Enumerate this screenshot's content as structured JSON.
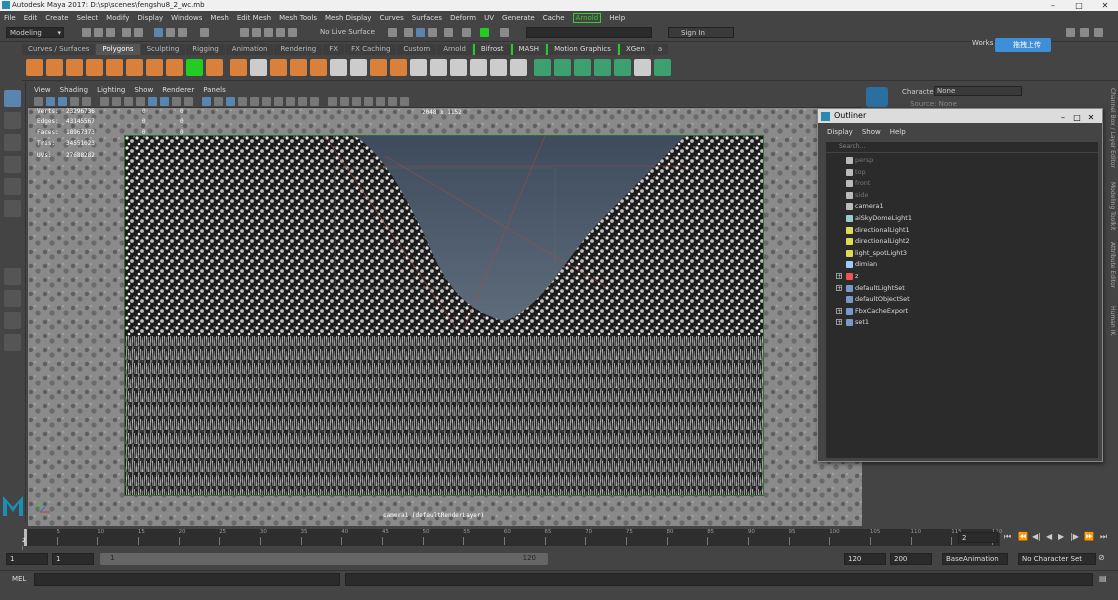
{
  "window": {
    "title": "Autodesk Maya 2017: D:\\sp\\scenes\\fengshu8_2_wc.mb",
    "workspace_label": "Works",
    "upload_badge": "拖拽上传"
  },
  "menubar": [
    "File",
    "Edit",
    "Create",
    "Select",
    "Modify",
    "Display",
    "Windows",
    "Mesh",
    "Edit Mesh",
    "Mesh Tools",
    "Mesh Display",
    "Curves",
    "Surfaces",
    "Deform",
    "UV",
    "Generate",
    "Cache",
    "Arnold",
    "Help"
  ],
  "status_line": {
    "mode": "Modeling",
    "live_surface": "No Live Surface",
    "sign_in": "Sign In"
  },
  "shelf_tabs": [
    {
      "label": "Curves / Surfaces",
      "active": false
    },
    {
      "label": "Polygons",
      "active": true
    },
    {
      "label": "Sculpting",
      "active": false
    },
    {
      "label": "Rigging",
      "active": false
    },
    {
      "label": "Animation",
      "active": false
    },
    {
      "label": "Rendering",
      "active": false
    },
    {
      "label": "FX",
      "active": false
    },
    {
      "label": "FX Caching",
      "active": false
    },
    {
      "label": "Custom",
      "active": false
    },
    {
      "label": "Arnold",
      "active": false
    },
    {
      "label": "Bifrost",
      "active": false
    },
    {
      "label": "MASH",
      "active": false
    },
    {
      "label": "Motion Graphics",
      "active": false
    },
    {
      "label": "XGen",
      "active": false
    },
    {
      "label": "a",
      "active": false
    }
  ],
  "viewport": {
    "menu": [
      "View",
      "Shading",
      "Lighting",
      "Show",
      "Renderer",
      "Panels"
    ],
    "hud": [
      {
        "label": "Verts:",
        "value": "23296736",
        "z1": "0",
        "z2": "0"
      },
      {
        "label": "Edges:",
        "value": "43145567",
        "z1": "0",
        "z2": "0"
      },
      {
        "label": "Faces:",
        "value": "18967373",
        "z1": "0",
        "z2": "0"
      },
      {
        "label": "Tris:",
        "value": "34551023",
        "z1": "0",
        "z2": "0"
      },
      {
        "label": "UVs:",
        "value": "27688282",
        "z1": "0",
        "z2": "0"
      }
    ],
    "resolution": "2048 x 1152",
    "camera_label": "camera1 (defaultRenderLayer)"
  },
  "right_panel": {
    "character_label": "Character:",
    "character_value": "None",
    "source_label": "Source:",
    "source_value": "None",
    "vertical_tabs": [
      "Channel Box / Layer Editor",
      "Modeling Toolkit",
      "Attribute Editor",
      "Human IK"
    ]
  },
  "outliner": {
    "title": "Outliner",
    "menu": [
      "Display",
      "Show",
      "Help"
    ],
    "search_placeholder": "Search...",
    "items": [
      {
        "label": "persp",
        "icon": "camera-icon",
        "dim": true,
        "expandable": false
      },
      {
        "label": "top",
        "icon": "camera-icon",
        "dim": true,
        "expandable": false
      },
      {
        "label": "front",
        "icon": "camera-icon",
        "dim": true,
        "expandable": false
      },
      {
        "label": "side",
        "icon": "camera-icon",
        "dim": true,
        "expandable": false
      },
      {
        "label": "camera1",
        "icon": "camera-icon",
        "dim": false,
        "expandable": false
      },
      {
        "label": "aiSkyDomeLight1",
        "icon": "skydome-light-icon",
        "dim": false,
        "expandable": false
      },
      {
        "label": "directionalLight1",
        "icon": "directional-light-icon",
        "dim": false,
        "expandable": false
      },
      {
        "label": "directionalLight2",
        "icon": "directional-light-icon",
        "dim": false,
        "expandable": false
      },
      {
        "label": "light_spotLight3",
        "icon": "spot-light-icon",
        "dim": false,
        "expandable": false
      },
      {
        "label": "dimian",
        "icon": "mesh-icon",
        "dim": false,
        "expandable": false
      },
      {
        "label": "z",
        "icon": "group-icon",
        "dim": false,
        "expandable": true
      },
      {
        "label": "defaultLightSet",
        "icon": "set-icon",
        "dim": false,
        "expandable": true
      },
      {
        "label": "defaultObjectSet",
        "icon": "set-icon",
        "dim": false,
        "expandable": false
      },
      {
        "label": "FbxCacheExport",
        "icon": "set-icon",
        "dim": false,
        "expandable": true
      },
      {
        "label": "set1",
        "icon": "set-icon",
        "dim": false,
        "expandable": true
      }
    ]
  },
  "time_slider": {
    "ticks": [
      "5",
      "10",
      "15",
      "20",
      "25",
      "30",
      "35",
      "40",
      "45",
      "50",
      "55",
      "60",
      "65",
      "70",
      "75",
      "80",
      "85",
      "90",
      "95",
      "100",
      "105",
      "110",
      "115",
      "120"
    ],
    "current_frame": "2",
    "current_frame_field": "2"
  },
  "range_slider": {
    "start_frame": "1",
    "playback_start": "1",
    "range_low": "1",
    "range_high": "120",
    "playback_end": "120",
    "end_frame": "200",
    "anim_layer": "BaseAnimation",
    "character_set": "No Character Set"
  },
  "command_line": {
    "label": "MEL"
  },
  "colors": {
    "accent": "#5a85b0",
    "arnold_green": "#33cc33",
    "panel_bg": "#444444",
    "field_bg": "#2b2b2b"
  }
}
